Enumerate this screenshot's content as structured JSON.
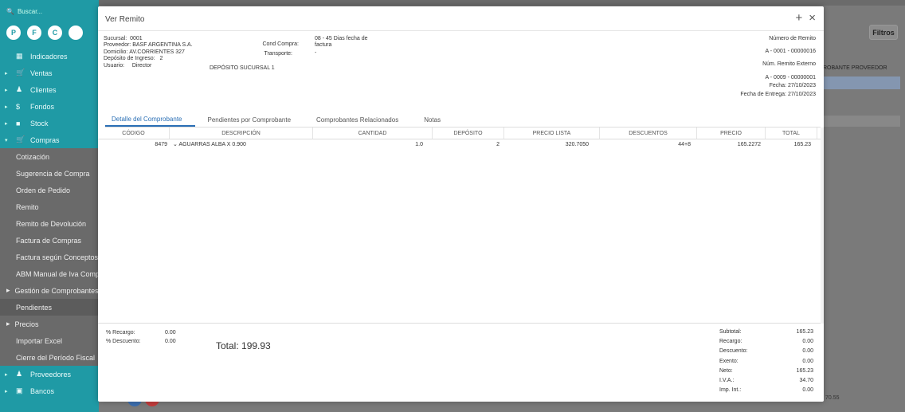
{
  "sidebar": {
    "search_placeholder": "Buscar...",
    "circles": [
      "P",
      "F",
      "C",
      ""
    ],
    "items": [
      {
        "label": "Indicadores",
        "icon": "grid-icon"
      },
      {
        "label": "Ventas",
        "icon": "cart-icon"
      },
      {
        "label": "Clientes",
        "icon": "people-icon"
      },
      {
        "label": "Fondos",
        "icon": "dollar-icon"
      },
      {
        "label": "Stock",
        "icon": "box-icon"
      },
      {
        "label": "Compras",
        "icon": "cart-icon"
      }
    ],
    "compras_sub": [
      {
        "label": "Cotización"
      },
      {
        "label": "Sugerencia de Compra"
      },
      {
        "label": "Orden de Pedido"
      },
      {
        "label": "Remito"
      },
      {
        "label": "Remito de Devolución"
      },
      {
        "label": "Factura de Compras"
      },
      {
        "label": "Factura según Conceptos"
      },
      {
        "label": "ABM Manual de Iva Compras"
      },
      {
        "label": "Gestión de Comprobantes"
      },
      {
        "label": "Pendientes"
      },
      {
        "label": "Precios"
      },
      {
        "label": "Importar Excel"
      },
      {
        "label": "Cierre del Período Fiscal"
      }
    ],
    "bottom_items": [
      {
        "label": "Proveedores",
        "icon": "people-icon"
      },
      {
        "label": "Bancos",
        "icon": "bank-icon"
      }
    ]
  },
  "background": {
    "filtros_label": "Filtros",
    "col_header": "ROBANTE PROVEEDOR",
    "bottom_value": "70.55"
  },
  "modal": {
    "title": "Ver Remito",
    "add_symbol": "+",
    "close_symbol": "×",
    "left_info": {
      "sucursal_label": "Sucursal:",
      "sucursal": "0001",
      "proveedor_label": "Proveedor:",
      "proveedor": "BASF ARGENTINA S.A.",
      "domicilio_label": "Domicilio:",
      "domicilio": "AV.CORRIENTES 327",
      "deposito_label": "Depósito de Ingreso:",
      "deposito": "2",
      "deposito_name": "DEPÓSITO SUCURSAL 1",
      "usuario_label": "Usuario:",
      "usuario": "Director"
    },
    "mid_info": {
      "cond_compra_label": "Cond Compra:",
      "cond_compra_1": "08 - 45 Dias fecha de",
      "cond_compra_2": "factura",
      "transporte_label": "Transporte:",
      "transporte": "-"
    },
    "right_info": {
      "numero_label": "Número de Remito",
      "numero": "A - 0001 - 00000016",
      "externo_label": "Núm. Remito Externo",
      "externo": "A - 0009 - 00000001",
      "fecha_label": "Fecha:",
      "fecha": "27/10/2023",
      "entrega_label": "Fecha de Entrega:",
      "entrega": "27/10/2023"
    },
    "tabs": [
      {
        "label": "Detalle del Comprobante"
      },
      {
        "label": "Pendientes por Comprobante"
      },
      {
        "label": "Comprobantes Relacionados"
      },
      {
        "label": "Notas"
      }
    ],
    "columns": [
      "CÓDIGO",
      "DESCRIPCIÓN",
      "CANTIDAD",
      "DEPÓSITO",
      "PRECIO LISTA",
      "DESCUENTOS",
      "PRECIO",
      "TOTAL"
    ],
    "rows": [
      {
        "codigo": "8479",
        "descripcion": "AGUARRAS ALBA X 0.900",
        "cantidad": "1.0",
        "deposito": "2",
        "precio_lista": "320.7050",
        "descuentos": "44+8",
        "precio": "165.2272",
        "total": "165.23"
      }
    ],
    "footer_left": {
      "recargo_label": "% Recargo:",
      "recargo": "0.00",
      "descuento_label": "% Descuento:",
      "descuento": "0.00",
      "total_text": "Total: 199.93"
    },
    "footer_right": [
      {
        "label": "Subtotal:",
        "value": "165.23"
      },
      {
        "label": "Recargo:",
        "value": "0.00"
      },
      {
        "label": "Descuento:",
        "value": "0.00"
      },
      {
        "label": "Exento:",
        "value": "0.00"
      },
      {
        "label": "Neto:",
        "value": "165.23"
      },
      {
        "label": "I.V.A.:",
        "value": "34.70"
      },
      {
        "label": "Imp. Int.:",
        "value": "0.00"
      }
    ]
  },
  "colors": {
    "sidebar": "#1f9aa5",
    "accent": "#2a6fb5",
    "overlay": "#7a7a7a"
  }
}
